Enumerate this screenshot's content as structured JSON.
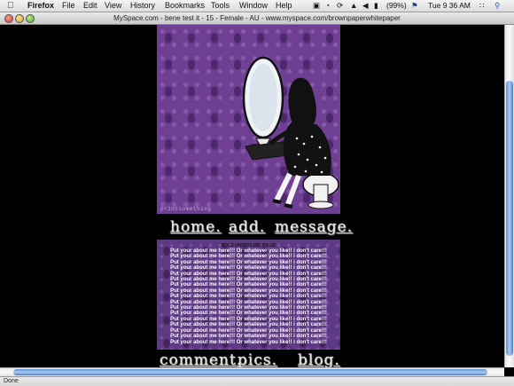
{
  "menubar": {
    "apple_icon": "apple-icon",
    "app_name": "Firefox",
    "items": [
      "File",
      "Edit",
      "View",
      "History",
      "Bookmarks",
      "Tools",
      "Window",
      "Help"
    ],
    "battery_text": "(99%)",
    "clock": "Tue 9 36 AM"
  },
  "window": {
    "title": "MySpace.com - bene test it - 15 - Female - AU - www.myspace.com/brownpaperwhitepaper"
  },
  "page": {
    "header_watermark": "printsomething",
    "nav_top": [
      "home.",
      "add.",
      "message."
    ],
    "about_heading": "BOLD UNDERLINE ITALIC",
    "about_lines": [
      "Put your about me here!!! Or whatever you like!! i don't care!!!",
      "Put your about me here!!! Or whatever you like!! i don't care!!!",
      "Put your about me here!!! Or whatever you like!! i don't care!!!",
      "Put your about me here!!! Or whatever you like!! i don't care!!!",
      "Put your about me here!!! Or whatever you like!! i don't care!!!",
      "Put your about me here!!! Or whatever you like!! i don't care!!!",
      "Put your about me here!!! Or whatever you like!! i don't care!!!",
      "Put your about me here!!! Or whatever you like!! i don't care!!!",
      "Put your about me here!!! Or whatever you like!! i don't care!!!",
      "Put your about me here!!! Or whatever you like!! i don't care!!!",
      "Put your about me here!!! Or whatever you like!! i don't care!!!",
      "Put your about me here!!! Or whatever you like!! i don't care!!!",
      "Put your about me here!!! Or whatever you like!! i don't care!!!",
      "Put your about me here!!! Or whatever you like!! i don't care!!!",
      "Put your about me here!!! Or whatever you like!! i don't care!!!",
      "Put your about me here!!! Or whatever you like!! i don't care!!!",
      "Put your about me here!!! Or whatever you like!! i don't care!!!"
    ],
    "nav_bottom": [
      "comment.",
      "pics.",
      "blog."
    ]
  },
  "status": {
    "text": "Done"
  },
  "colors": {
    "background": "#000000",
    "damask_purple": "#6e3f93",
    "scroll_blue": "#5a8fd6"
  }
}
